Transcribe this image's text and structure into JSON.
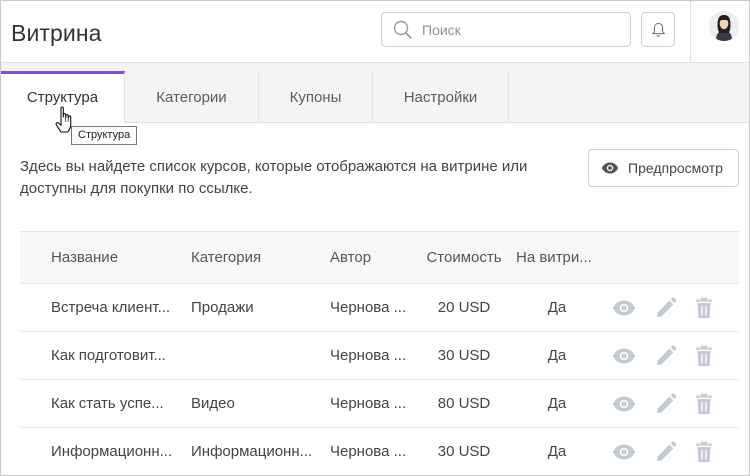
{
  "header": {
    "title": "Витрина",
    "search_placeholder": "Поиск"
  },
  "tabs": [
    {
      "label": "Структура",
      "active": true
    },
    {
      "label": "Категории",
      "active": false
    },
    {
      "label": "Купоны",
      "active": false
    },
    {
      "label": "Настройки",
      "active": false
    }
  ],
  "tooltip": "Структура",
  "description": "Здесь вы найдете список курсов, которые отображаются на витрине или доступны для покупки по ссылке.",
  "preview_button": "Предпросмотр",
  "table": {
    "columns": [
      "Название",
      "Категория",
      "Автор",
      "Стоимость",
      "На витри..."
    ],
    "rows": [
      {
        "name": "Встреча клиент...",
        "category": "Продажи",
        "author": "Чернова ...",
        "price": "20 USD",
        "on_showcase": "Да"
      },
      {
        "name": "Как подготовит...",
        "category": "",
        "author": "Чернова ...",
        "price": "30 USD",
        "on_showcase": "Да"
      },
      {
        "name": "Как стать успе...",
        "category": "Видео",
        "author": "Чернова ...",
        "price": "80 USD",
        "on_showcase": "Да"
      },
      {
        "name": "Информационн...",
        "category": "Информационн...",
        "author": "Чернова ...",
        "price": "30 USD",
        "on_showcase": "Да"
      }
    ]
  },
  "colors": {
    "accent": "#8a4cd6",
    "icon_gray": "#c3c9d2",
    "header_bg": "#f6f7f9"
  },
  "icons": [
    "search-icon",
    "bell-icon",
    "eye-icon",
    "pencil-icon",
    "trash-icon",
    "hand-cursor-icon"
  ]
}
